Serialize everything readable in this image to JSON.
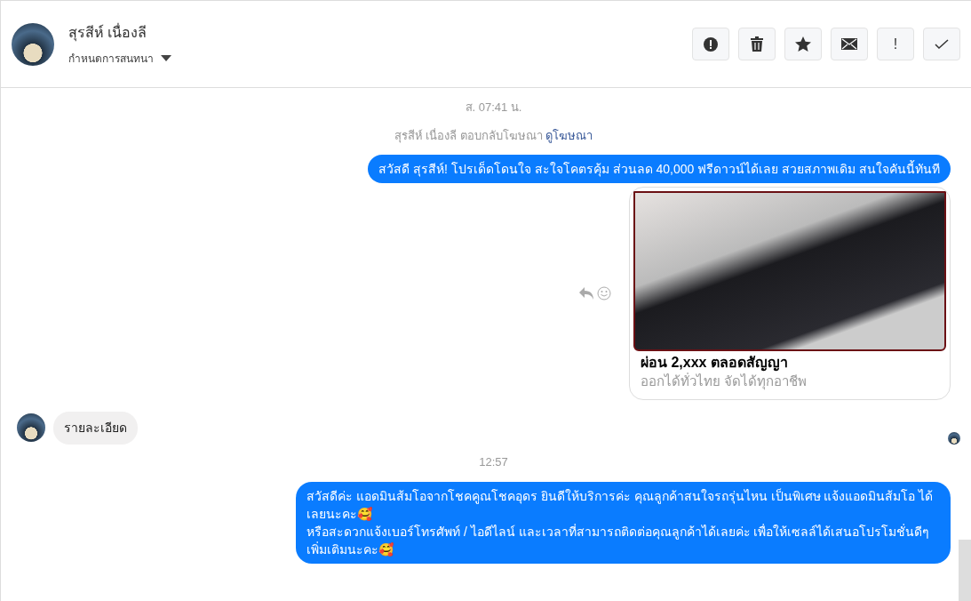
{
  "header": {
    "name": "สุรสีห์ เนื่องลี",
    "subtitle": "กำหนดการสนทนา",
    "actions": [
      {
        "kind": "alert"
      },
      {
        "kind": "trash"
      },
      {
        "kind": "star"
      },
      {
        "kind": "mail"
      },
      {
        "kind": "exclaim",
        "label": "!"
      },
      {
        "kind": "check"
      }
    ]
  },
  "messages": [
    {
      "kind": "timestamp",
      "text": "ส. 07:41 น."
    },
    {
      "kind": "ad_reply",
      "text": "สุรสีห์ เนื่องลี ตอบกลับโฆษณา",
      "link": "ดูโฆษณา"
    },
    {
      "kind": "outgoing",
      "text": "สวัสดี สุรสีห์! โปรเด็ดโดนใจ สะใจโคตรคุ้ม ส่วนลด 40,000 ฟรีดาวน์ได้เลย สวยสภาพเดิม สนใจคันนี้ทันที"
    },
    {
      "kind": "card",
      "title": "ผ่อน 2,xxx ตลอดสัญญา",
      "subtitle": "ออกได้ทั่วไทย จัดได้ทุกอาชีพ"
    },
    {
      "kind": "incoming",
      "text": "รายละเอียด",
      "seen": true
    },
    {
      "kind": "timestamp",
      "text": "12:57"
    },
    {
      "kind": "outgoing",
      "text": "สวัสดีค่ะ แอดมินส้มโอจากโชคคูณโชคอุดร ยินดีให้บริการค่ะ   คุณลูกค้าสนใจรถรุ่นไหน เป็นพิเศษ แจ้งแอดมินส้มโอ ได้เลยนะคะ🥰\nหรือสะดวกแจ้งเบอร์โทรศัพท์ / ไอดีไลน์ และเวลาที่สามารถติดต่อคุณลูกค้าได้เลยค่ะ เพื่อให้เซลล์ได้เสนอโปรโมชั่นดีๆเพิ่มเติมนะคะ🥰"
    }
  ]
}
